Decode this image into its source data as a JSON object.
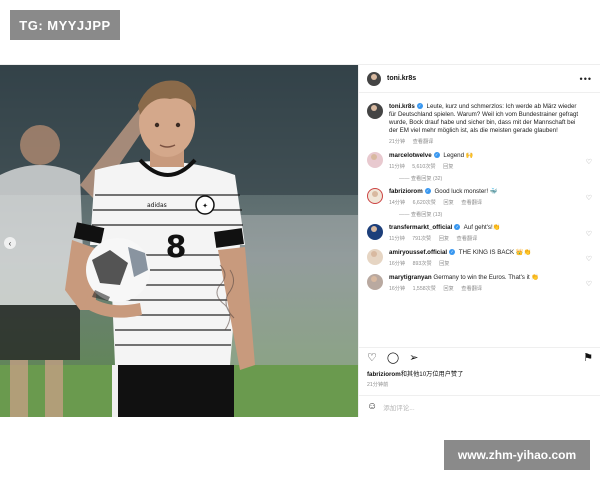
{
  "watermarks": {
    "top": "TG: MYYJJPP",
    "bottom": "www.zhm-yihao.com"
  },
  "post": {
    "username": "toni.kr8s",
    "caption_user": "toni.kr8s",
    "caption": "Leute, kurz und schmerzlos: Ich werde ab März wieder für Deutschland spielen. Warum? Weil ich vom Bundestrainer gefragt wurde, Bock drauf habe und sicher bin, dass mit der Mannschaft bei der EM viel mehr möglich ist, als die meisten gerade glauben!",
    "caption_time": "21分钟",
    "caption_translate": "查看翻译",
    "photo_shirt_number": "8"
  },
  "comments": [
    {
      "user": "marcelotwelve",
      "verified": true,
      "text": "Legend 🙌",
      "time": "11分钟",
      "likes": "5,610次赞",
      "reply": "回复",
      "translate": "",
      "view_replies": "查看回复 (32)",
      "avatar_color": "#e8c9cf"
    },
    {
      "user": "fabriziorom",
      "verified": true,
      "text": "Good luck monster! 🐳",
      "time": "14分钟",
      "likes": "6,620次赞",
      "reply": "回复",
      "translate": "查看翻译",
      "view_replies": "查看回复 (13)",
      "avatar_color": "#f0e6d8"
    },
    {
      "user": "transfermarkt_official",
      "verified": true,
      "text": "Auf geht's!👏",
      "time": "11分钟",
      "likes": "791次赞",
      "reply": "回复",
      "translate": "查看翻译",
      "view_replies": "",
      "avatar_color": "#1d3f7a"
    },
    {
      "user": "amiryoussef.official",
      "verified": true,
      "text": "THE KING IS BACK 👑👏",
      "time": "16分钟",
      "likes": "893次赞",
      "reply": "回复",
      "translate": "",
      "view_replies": "",
      "avatar_color": "#e6d5c3"
    },
    {
      "user": "marytigranyan",
      "verified": false,
      "text": "Germany to win the Euros. That's it 👏",
      "time": "16分钟",
      "likes": "1,558次赞",
      "reply": "回复",
      "translate": "查看翻译",
      "view_replies": "",
      "avatar_color": "#b9a9a0"
    }
  ],
  "actions": {
    "like_icon": "heart-icon",
    "comment_icon": "comment-icon",
    "share_icon": "share-icon",
    "save_icon": "bookmark-icon"
  },
  "likes_user": "fabriziorom",
  "likes_text": "和其他10万位用户赞了",
  "post_time": "21分钟前",
  "add_comment_placeholder": "添加评论..."
}
